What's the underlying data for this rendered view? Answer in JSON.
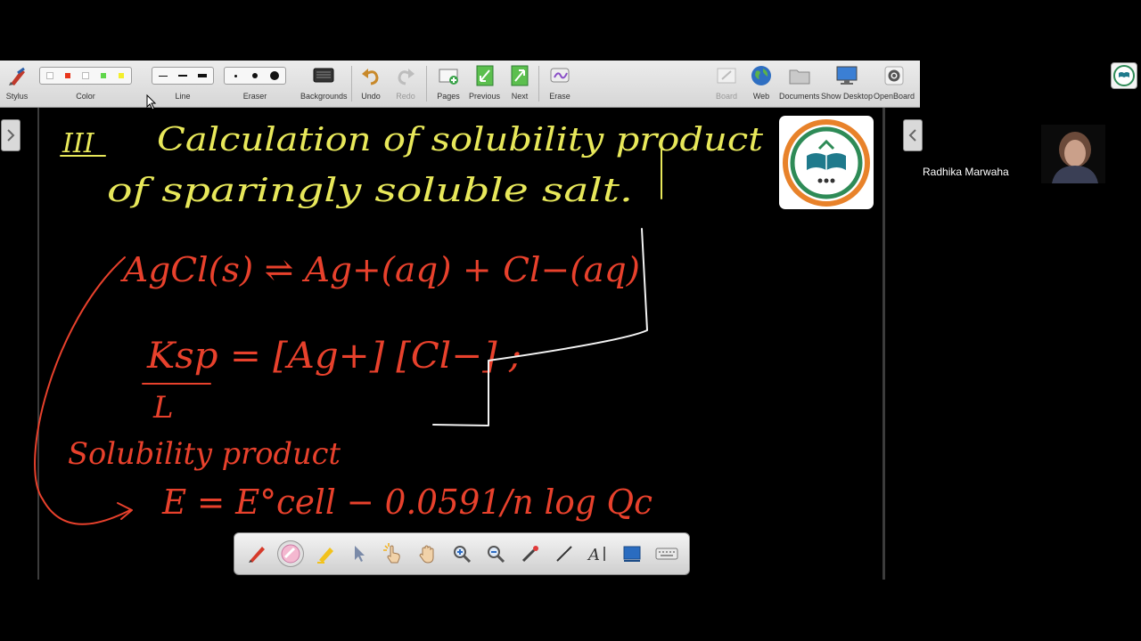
{
  "toolbar": {
    "stylus": "Stylus",
    "color": "Color",
    "line": "Line",
    "eraser": "Eraser",
    "backgrounds": "Backgrounds",
    "undo": "Undo",
    "redo": "Redo",
    "pages": "Pages",
    "previous": "Previous",
    "next": "Next",
    "erase": "Erase",
    "board": "Board",
    "web": "Web",
    "documents": "Documents",
    "show_desktop": "Show Desktop",
    "openboard": "OpenBoard",
    "swatch_colors": [
      "#ffffff",
      "#e8361c",
      "#ffffff",
      "#5fd64a",
      "#f3ef2c"
    ]
  },
  "board": {
    "ink_colors": {
      "yellow": "#e8e85a",
      "red": "#e8412c",
      "white": "#f2f2f2"
    },
    "heading_number": "III",
    "heading_line1": "Calculation of solubility product",
    "heading_line2": "of sparingly soluble salt.",
    "eq_reaction": "AgCl(s) ⇌ Ag+(aq) + Cl−(aq)",
    "eq_ksp": "Ksp = [Ag+] [Cl−] ;",
    "eq_ksp_below": "L",
    "eq_solubility": "Solubility product",
    "eq_nernst": "E = E°cell − 0.0591/n log Qc"
  },
  "floatbar": {
    "tools": [
      "pen-tool",
      "eraser-tool",
      "marker-tool",
      "selector-tool",
      "interact-tool",
      "hand-tool",
      "zoom-in-tool",
      "zoom-out-tool",
      "laser-pointer-tool",
      "line-tool",
      "text-tool",
      "capture-tool",
      "virtual-keyboard-tool"
    ]
  },
  "participant": {
    "name": "Radhika Marwaha"
  }
}
